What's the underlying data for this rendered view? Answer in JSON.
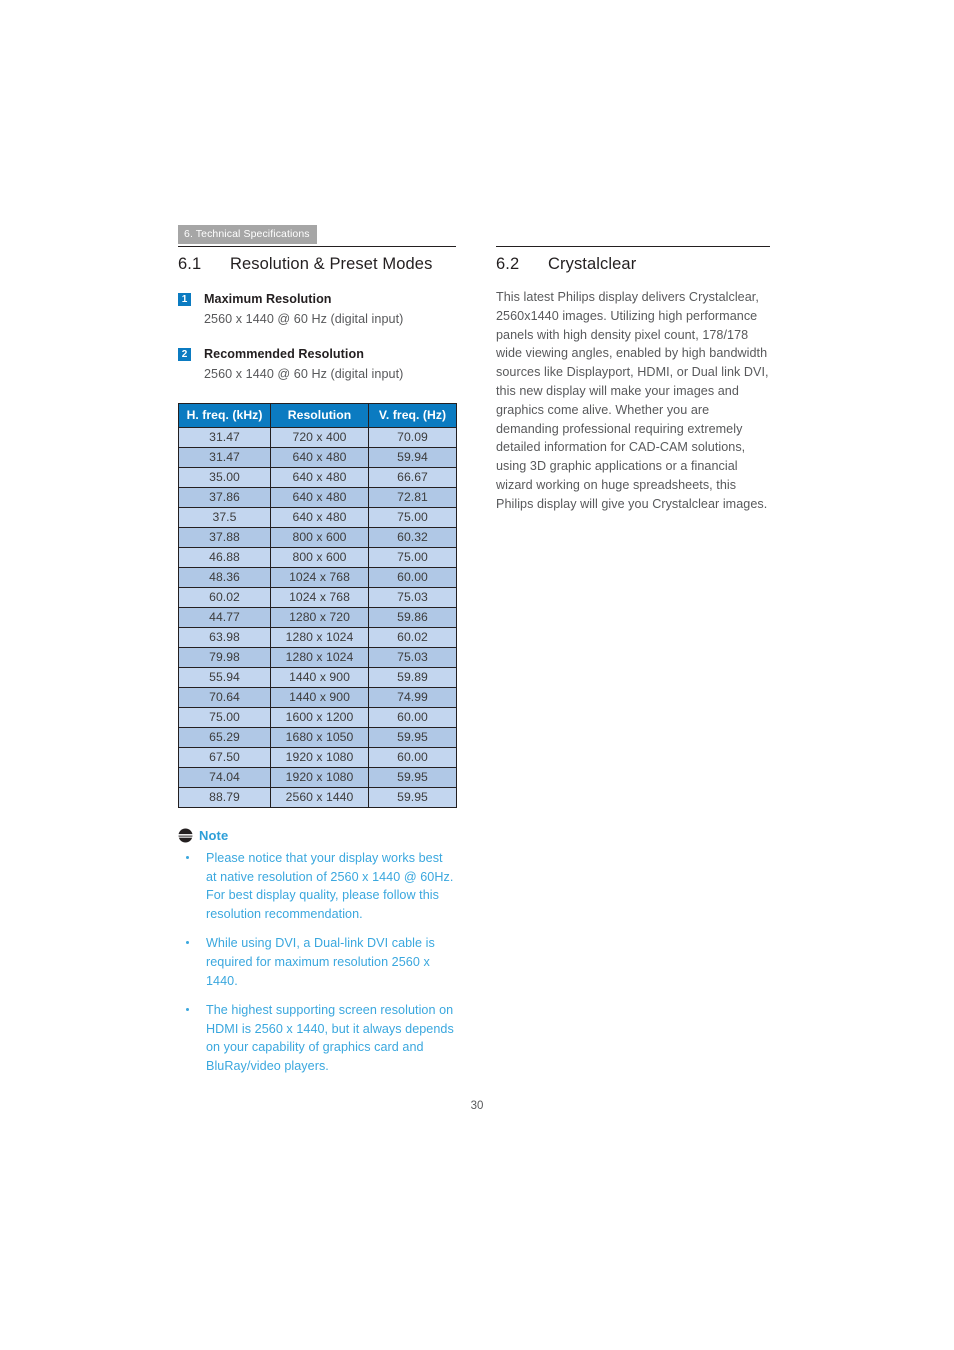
{
  "header": {
    "running_head": "6. Technical Specifications"
  },
  "left_column": {
    "section": {
      "number": "6.1",
      "title": "Resolution & Preset Modes"
    },
    "items": [
      {
        "badge": "1",
        "title": "Maximum Resolution",
        "subtitle": "2560 x 1440 @ 60 Hz (digital input)"
      },
      {
        "badge": "2",
        "title": "Recommended Resolution",
        "subtitle": "2560 x 1440 @ 60 Hz (digital input)"
      }
    ],
    "table": {
      "columns": [
        "H. freq. (kHz)",
        "Resolution",
        "V. freq. (Hz)"
      ],
      "rows": [
        [
          "31.47",
          "720 x 400",
          "70.09"
        ],
        [
          "31.47",
          "640 x 480",
          "59.94"
        ],
        [
          "35.00",
          "640 x 480",
          "66.67"
        ],
        [
          "37.86",
          "640 x 480",
          "72.81"
        ],
        [
          "37.5",
          "640 x 480",
          "75.00"
        ],
        [
          "37.88",
          "800 x 600",
          "60.32"
        ],
        [
          "46.88",
          "800 x 600",
          "75.00"
        ],
        [
          "48.36",
          "1024 x 768",
          "60.00"
        ],
        [
          "60.02",
          "1024 x 768",
          "75.03"
        ],
        [
          "44.77",
          "1280 x 720",
          "59.86"
        ],
        [
          "63.98",
          "1280 x 1024",
          "60.02"
        ],
        [
          "79.98",
          "1280 x 1024",
          "75.03"
        ],
        [
          "55.94",
          "1440 x 900",
          "59.89"
        ],
        [
          "70.64",
          "1440 x 900",
          "74.99"
        ],
        [
          "75.00",
          "1600 x 1200",
          "60.00"
        ],
        [
          "65.29",
          "1680 x 1050",
          "59.95"
        ],
        [
          "67.50",
          "1920 x 1080",
          "60.00"
        ],
        [
          "74.04",
          "1920 x 1080",
          "59.95"
        ],
        [
          "88.79",
          "2560 x 1440",
          "59.95"
        ]
      ]
    },
    "note": {
      "icon": "note-icon",
      "label": "Note",
      "bullets": [
        "Please notice that your display works best at native resolution of 2560 x 1440 @ 60Hz. For best display quality, please follow this resolution recommendation.",
        "While using DVI, a Dual-link DVI cable is required for maximum resolution 2560 x 1440.",
        "The highest supporting screen resolution on HDMI is 2560 x 1440, but it always depends on your capability of graphics card and BluRay/video players."
      ]
    }
  },
  "right_column": {
    "section": {
      "number": "6.2",
      "title": "Crystalclear"
    },
    "body": "This latest Philips display delivers Crystalclear, 2560x1440 images. Utilizing high performance panels with high density pixel count, 178/178 wide viewing angles, enabled by high bandwidth sources like Displayport, HDMI, or Dual link DVI, this new display will make your images and graphics come alive. Whether you are demanding professional requiring extremely detailed information for CAD-CAM solutions, using 3D graphic applications or a financial wizard working on huge spreadsheets, this Philips display will give you Crystalclear images."
  },
  "footer": {
    "page_number": "30"
  },
  "colors": {
    "accent_blue": "#0b7bc1",
    "note_blue": "#3aa7de",
    "header_tab_gray": "#a6a6a6",
    "row_light": "#c3d6ef",
    "row_dark": "#b0c8e6",
    "text_dark": "#231f20",
    "text_gray": "#58595b"
  }
}
